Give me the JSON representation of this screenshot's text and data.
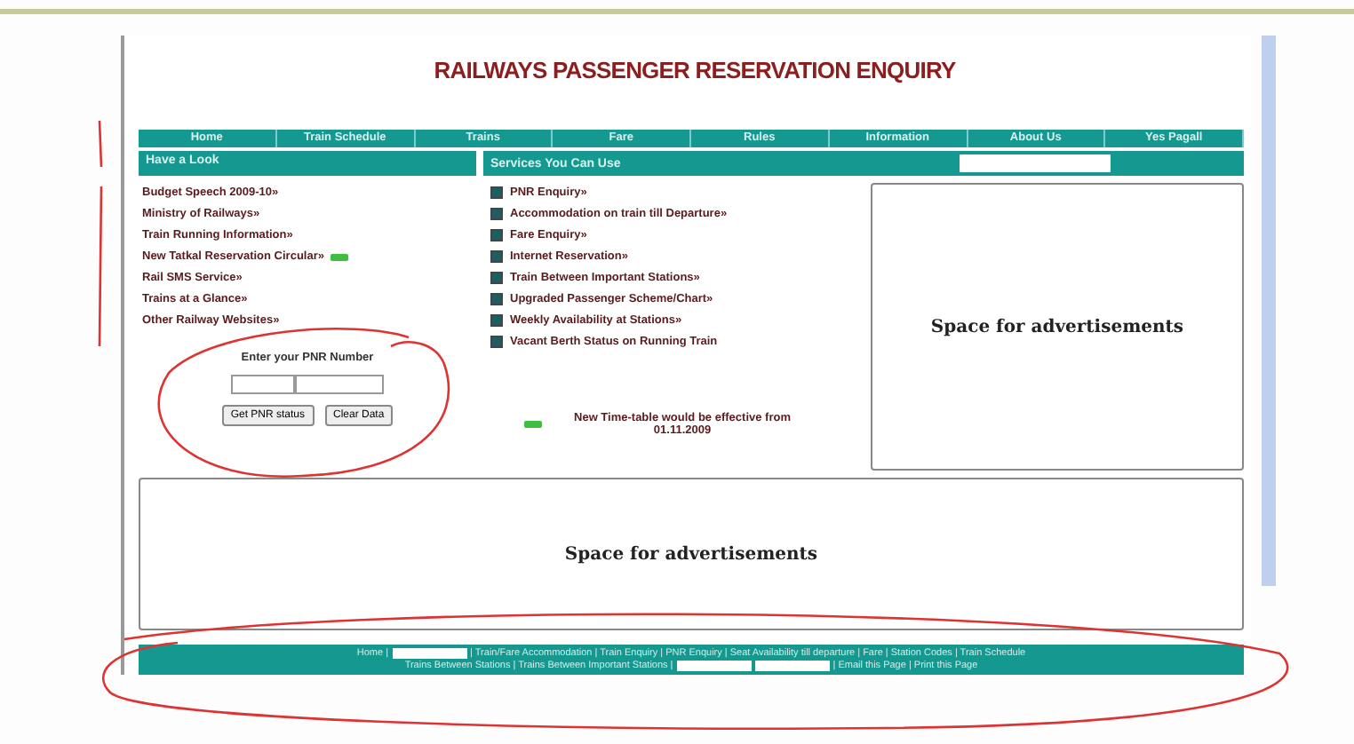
{
  "title": "RAILWAYS PASSENGER RESERVATION ENQUIRY",
  "nav": [
    "Home",
    "Train Schedule",
    "Trains",
    "Fare",
    "Rules",
    "Information",
    "About Us",
    "Yes Pagall"
  ],
  "left_header": "Have a Look",
  "right_header": "Services You Can Use",
  "look_links": [
    {
      "label": "Budget Speech 2009-10»",
      "new": false
    },
    {
      "label": "Ministry of Railways»",
      "new": false
    },
    {
      "label": "Train Running Information»",
      "new": false
    },
    {
      "label": "New Tatkal Reservation Circular»",
      "new": true
    },
    {
      "label": "Rail SMS Service»",
      "new": false
    },
    {
      "label": "Trains at a Glance»",
      "new": false
    },
    {
      "label": "Other Railway Websites»",
      "new": false
    }
  ],
  "pnr": {
    "label": "Enter your PNR Number",
    "buttons": [
      "Get PNR status",
      "Clear Data"
    ]
  },
  "services": [
    "PNR Enquiry»",
    "Accommodation on train till Departure»",
    "Fare Enquiry»",
    "Internet Reservation»",
    "Train Between Important Stations»",
    "Upgraded Passenger Scheme/Chart»",
    "Weekly Availability at Stations»",
    "Vacant Berth Status on Running Train"
  ],
  "notice": {
    "text": "New Time-table would be effective from 01.11.2009",
    "new": true
  },
  "side_ad": "Space for advertisements",
  "bottom_ad": "Space for advertisements",
  "footer": {
    "line_1": [
      {
        "kind": "link",
        "text": "Home |"
      },
      {
        "kind": "field"
      },
      {
        "kind": "link",
        "text": "| Train/Fare Accommodation | Train Enquiry | PNR Enquiry | Seat Availability till departure | Fare | Station Codes | Train Schedule"
      }
    ],
    "line_2": [
      {
        "kind": "link",
        "text": "Trains Between Stations | Trains Between Important Stations |"
      },
      {
        "kind": "field"
      },
      {
        "kind": "field"
      },
      {
        "kind": "link",
        "text": "| Email this Page | Print this Page"
      }
    ]
  }
}
